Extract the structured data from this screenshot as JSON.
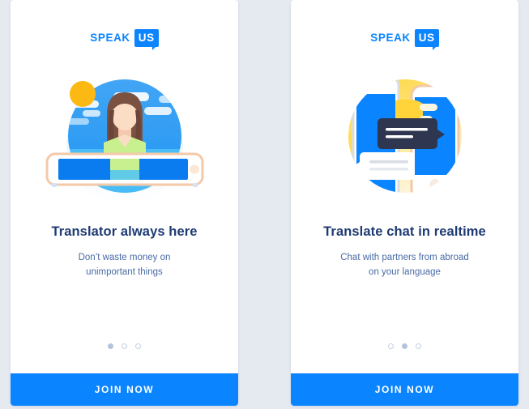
{
  "page": {
    "background_color": "#e5e9f0",
    "accent_color": "#0b84ff",
    "title_color": "#1e3a72",
    "subtitle_color": "#4a6ba5"
  },
  "brand": {
    "word_main": "SPEAK",
    "word_badge": "US"
  },
  "cards": [
    {
      "id": "translator-always-here",
      "logo_main": "SPEAK",
      "logo_badge": "US",
      "illustration_name": "woman-with-laptop-illustration",
      "title": "Translator always here",
      "subtitle": "Don’t waste money on\nunimportant things",
      "subtitle_line1": "Don’t waste money on",
      "subtitle_line2": "unimportant things",
      "dots": {
        "count": 3,
        "active_index": 0
      },
      "button_label": "JOIN NOW"
    },
    {
      "id": "translate-chat-in-realtime",
      "logo_main": "SPEAK",
      "logo_badge": "US",
      "illustration_name": "two-phones-chat-illustration",
      "title": "Translate chat in realtime",
      "subtitle": "Chat with partners from abroad\non your language",
      "subtitle_line1": "Chat with partners from abroad",
      "subtitle_line2": "on your language",
      "dots": {
        "count": 3,
        "active_index": 1
      },
      "button_label": "JOIN NOW"
    }
  ]
}
